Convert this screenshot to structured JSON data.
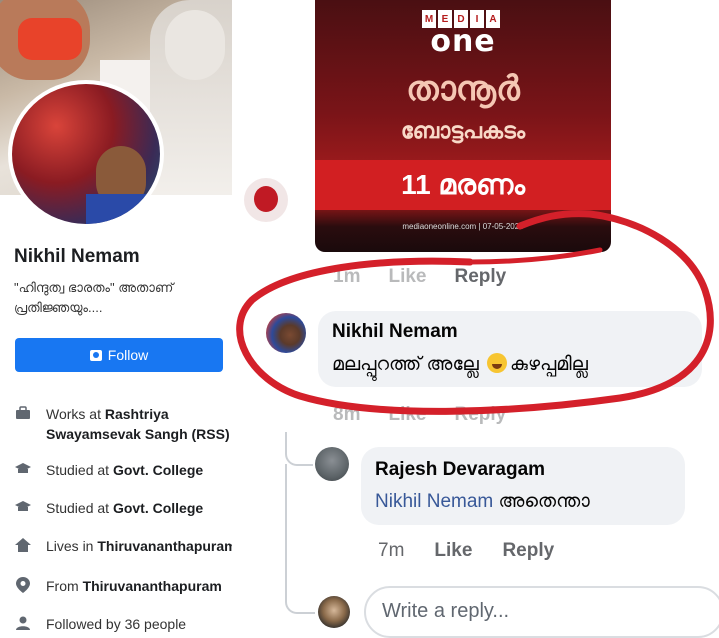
{
  "profile": {
    "name": "Nikhil Nemam",
    "bio": "\"ഹിന്ദുത്വ ഭാരതം\" അതാണ് പ്രതിജ്ഞയും....",
    "follow_label": "Follow",
    "info": [
      {
        "icon": "briefcase-icon",
        "prefix": "Works at ",
        "value": "Rashtriya Swayamsevak Sangh (RSS)"
      },
      {
        "icon": "graduation-cap-icon",
        "prefix": "Studied at ",
        "value": "Govt. College"
      },
      {
        "icon": "graduation-cap-icon",
        "prefix": "Studied at ",
        "value": "Govt. College"
      },
      {
        "icon": "home-icon",
        "prefix": "Lives in ",
        "value": "Thiruvananthapuram"
      },
      {
        "icon": "location-pin-icon",
        "prefix": "From ",
        "value": "Thiruvananthapuram"
      },
      {
        "icon": "followers-icon",
        "prefix": "",
        "value": "Followed by 36 people"
      }
    ]
  },
  "news_card": {
    "logo_top": [
      "M",
      "E",
      "D",
      "I",
      "A"
    ],
    "logo_main": "one",
    "headline_1": "താനൂർ",
    "headline_2": "ബോട്ടപകടം",
    "band_text": "11 മരണം",
    "footer": "mediaoneonline.com | 07-05-2023"
  },
  "post_meta": {
    "time": "1m",
    "like": "Like",
    "reply": "Reply"
  },
  "comments": [
    {
      "author": "Nikhil Nemam",
      "text_before_emoji": "മലപ്പുറത്ത് അല്ലേ",
      "emoji": "laughing-emoji",
      "text_after_emoji": "കുഴപ്പമില്ല",
      "time": "8m",
      "like": "Like",
      "reply": "Reply"
    },
    {
      "author": "Rajesh Devaragam",
      "mention": "Nikhil Nemam",
      "text": "അതെന്താ",
      "time": "7m",
      "like": "Like",
      "reply": "Reply"
    }
  ],
  "reply_input": {
    "placeholder": "Write a reply..."
  },
  "colors": {
    "facebook_blue": "#1877f2",
    "annotation_red": "#d4202a",
    "bubble_bg": "#f0f2f5"
  }
}
